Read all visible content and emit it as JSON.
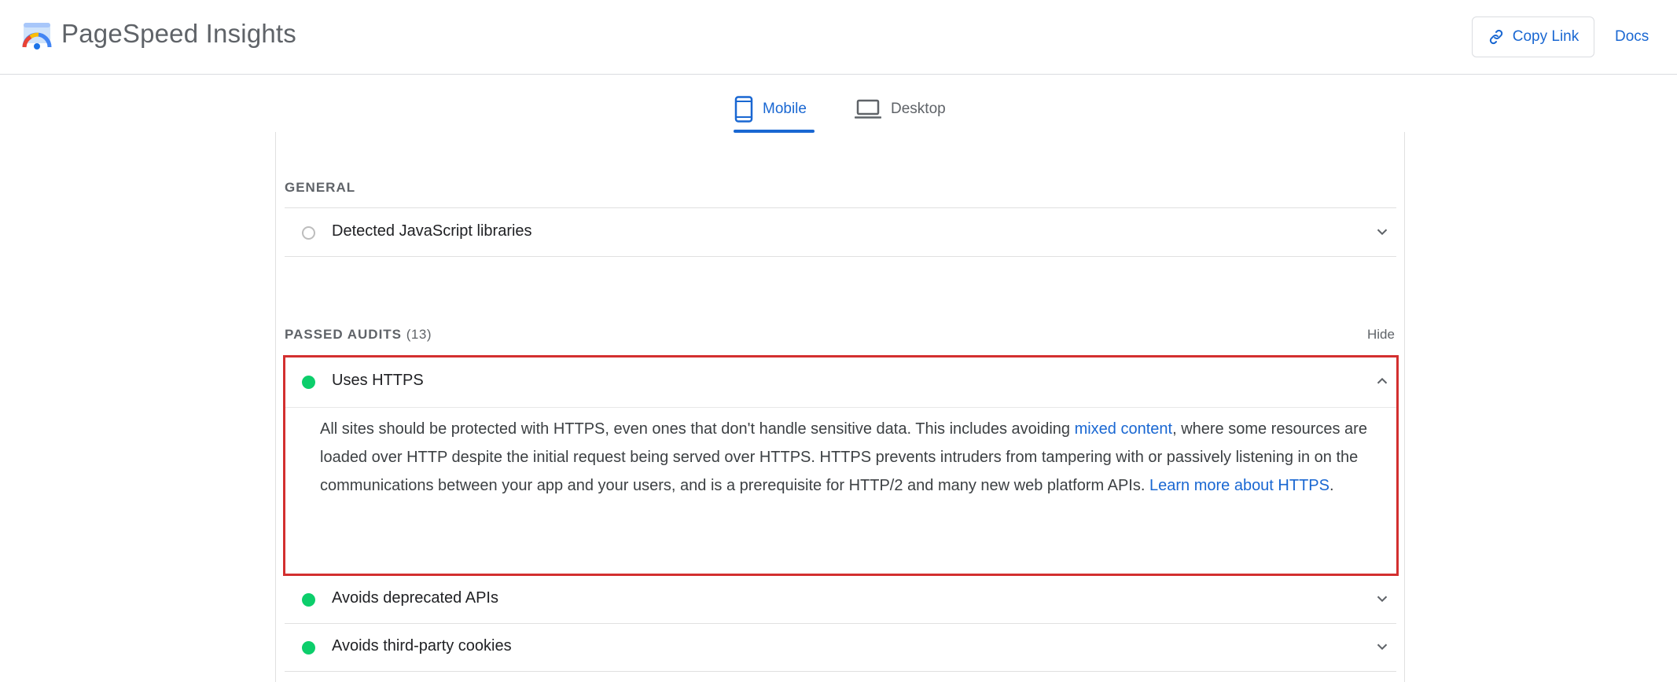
{
  "app": {
    "title": "PageSpeed Insights"
  },
  "header": {
    "copy_link_label": "Copy Link",
    "docs_label": "Docs"
  },
  "tabs": [
    {
      "label": "Mobile",
      "active": true
    },
    {
      "label": "Desktop",
      "active": false
    }
  ],
  "general": {
    "heading": "GENERAL",
    "audits": [
      {
        "title": "Detected JavaScript libraries",
        "status": "informative"
      }
    ]
  },
  "passed": {
    "heading": "PASSED AUDITS",
    "count": "(13)",
    "hide_label": "Hide",
    "expanded": {
      "title": "Uses HTTPS",
      "status": "pass",
      "description": {
        "part1": "All sites should be protected with HTTPS, even ones that don't handle sensitive data. This includes avoiding ",
        "link1": "mixed content",
        "part2": ", where some resources are loaded over HTTP despite the initial request being served over HTTPS. HTTPS prevents intruders from tampering with or passively listening in on the communications between your app and your users, and is a prerequisite for HTTP/2 and many new web platform APIs. ",
        "link2": "Learn more about HTTPS",
        "part3": "."
      }
    },
    "audits": [
      {
        "title": "Avoids deprecated APIs",
        "status": "pass"
      },
      {
        "title": "Avoids third-party cookies",
        "status": "pass"
      }
    ]
  },
  "colors": {
    "accent": "#1967d2",
    "pass": "#0cce6b",
    "highlight": "#d32f2f",
    "muted": "#5f6368"
  },
  "icons": {
    "logo": "pagespeed-logo-icon",
    "copy": "link-icon",
    "mobile": "smartphone-icon",
    "desktop": "laptop-icon",
    "chevron_down": "chevron-down-icon",
    "chevron_up": "chevron-up-icon"
  }
}
